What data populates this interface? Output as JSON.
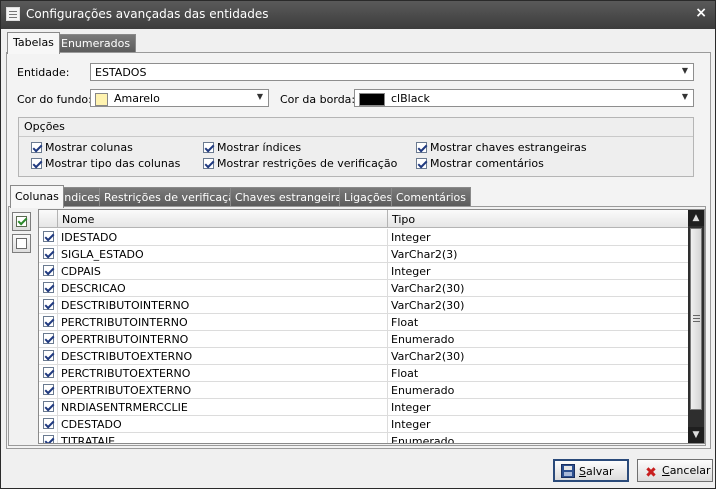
{
  "window": {
    "title": "Configurações avançadas das entidades",
    "close_glyph": "×"
  },
  "top_tabs": [
    {
      "label": "Tabelas",
      "active": true
    },
    {
      "label": "Enumerados",
      "active": false
    }
  ],
  "form": {
    "entidade_label": "Entidade:",
    "entidade_value": "ESTADOS",
    "cor_fundo_label": "Cor do fundo:",
    "cor_fundo_value": "Amarelo",
    "cor_fundo_color": "#fff3b0",
    "cor_borda_label": "Cor da borda:",
    "cor_borda_value": "clBlack",
    "cor_borda_color": "#000000"
  },
  "opcoes": {
    "legend": "Opções",
    "items": [
      {
        "label": "Mostrar colunas",
        "checked": true
      },
      {
        "label": "Mostrar índices",
        "checked": true
      },
      {
        "label": "Mostrar chaves estrangeiras",
        "checked": true
      },
      {
        "label": "Mostrar tipo das colunas",
        "checked": true
      },
      {
        "label": "Mostrar restrições de verificação",
        "checked": true
      },
      {
        "label": "Mostrar comentários",
        "checked": true
      }
    ]
  },
  "sub_tabs": [
    {
      "label": "Colunas",
      "active": true
    },
    {
      "label": "Índices",
      "active": false
    },
    {
      "label": "Restrições de verificação",
      "active": false
    },
    {
      "label": "Chaves estrangeiras",
      "active": false
    },
    {
      "label": "Ligações",
      "active": false
    },
    {
      "label": "Comentários",
      "active": false
    }
  ],
  "grid": {
    "columns": [
      "Nome",
      "Tipo"
    ],
    "rows": [
      {
        "checked": true,
        "nome": "IDESTADO",
        "tipo": "Integer"
      },
      {
        "checked": true,
        "nome": "SIGLA_ESTADO",
        "tipo": "VarChar2(3)"
      },
      {
        "checked": true,
        "nome": "CDPAIS",
        "tipo": "Integer"
      },
      {
        "checked": true,
        "nome": "DESCRICAO",
        "tipo": "VarChar2(30)"
      },
      {
        "checked": true,
        "nome": "DESCTRIBUTOINTERNO",
        "tipo": "VarChar2(30)"
      },
      {
        "checked": true,
        "nome": "PERCTRIBUTOINTERNO",
        "tipo": "Float"
      },
      {
        "checked": true,
        "nome": "OPERTRIBUTOINTERNO",
        "tipo": "Enumerado"
      },
      {
        "checked": true,
        "nome": "DESCTRIBUTOEXTERNO",
        "tipo": "VarChar2(30)"
      },
      {
        "checked": true,
        "nome": "PERCTRIBUTOEXTERNO",
        "tipo": "Float"
      },
      {
        "checked": true,
        "nome": "OPERTRIBUTOEXTERNO",
        "tipo": "Enumerado"
      },
      {
        "checked": true,
        "nome": "NRDIASENTRMERCCLIE",
        "tipo": "Integer"
      },
      {
        "checked": true,
        "nome": "CDESTADO",
        "tipo": "Integer"
      },
      {
        "checked": true,
        "nome": "TITRATAIE",
        "tipo": "Enumerado"
      }
    ]
  },
  "buttons": {
    "salvar_pre": "",
    "salvar_ul": "S",
    "salvar_post": "alvar",
    "cancelar_pre": "",
    "cancelar_ul": "C",
    "cancelar_post": "ancelar"
  },
  "icons": {
    "window": "table-icon",
    "save": "floppy-disk-icon",
    "cancel": "red-x-icon",
    "select_all": "check-all-icon",
    "select_none": "uncheck-all-icon"
  }
}
